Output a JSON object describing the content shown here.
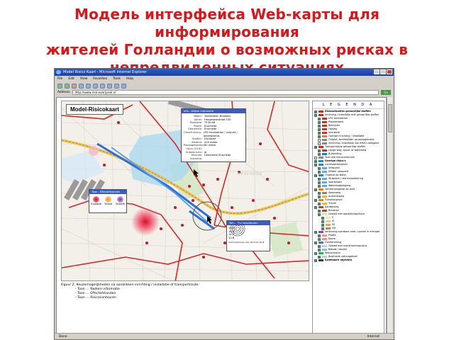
{
  "slide": {
    "title_lines": [
      "Модель интерфейса Web-карты для информирования",
      "жителей Голландии о возможных рисках в",
      "непредвиденных ситуациях"
    ]
  },
  "browser": {
    "window_title": "Model Risico Kaart - Microsoft Internet Explorer",
    "menu": [
      "File",
      "Edit",
      "View",
      "Favorites",
      "Tools",
      "Help"
    ],
    "address_label": "Address",
    "address_value": "http://www.risk-overijssel.nl",
    "go_label": "Go",
    "status_left": "Done",
    "status_zone": "Internet"
  },
  "map": {
    "title": "Model-Risicokaart",
    "place_label": "EVSCHEDE",
    "info_popup": {
      "header": "Info - Wijken informatie",
      "rows": [
        {
          "k": "Naam:",
          "v": "Tankstation Broekeln"
        },
        {
          "k": "Adres:",
          "v": "Hengelosestraat 100"
        },
        {
          "k": "Postcode:",
          "v": "7534 AB"
        },
        {
          "k": "Plaats:",
          "v": "Enschede"
        },
        {
          "k": "Gemeente:",
          "v": "Enschede"
        },
        {
          "k": "Omschrijving:",
          "v": "LPG tankstation / vulpunt / ondergronds"
        },
        {
          "k": "Stoffen:",
          "v": "Explosief"
        },
        {
          "k": "Afstand:",
          "v": "200 meter"
        },
        {
          "k": "Plaatsgebonden risico (10-6):",
          "v": "80 meter"
        },
        {
          "k": "Groepsrisico:",
          "v": "Ja"
        },
        {
          "k": "Verantw. instantie:",
          "v": "Gemeente Enschede"
        }
      ]
    },
    "effects_popup": {
      "header": "Toon - Effectafstanden",
      "items": [
        "Explosie",
        "Brand",
        "Gifwolk"
      ]
    },
    "contour_popup": {
      "header": "Toon - Risicocontouren",
      "items": [
        "10-5",
        "10-6",
        "10-7",
        "10-8"
      ],
      "note": "risicocontouren van 10-5 tot 10-8"
    }
  },
  "legend": {
    "title": "L E G E N D A",
    "items": [
      {
        "label": "Risicosituaties gevaarlijke stoffen",
        "level": 0,
        "checked": true,
        "color": "#d62828"
      },
      {
        "label": "Inrichting / installatie met gevaarlijke stoffen",
        "level": 1,
        "checked": true,
        "color": "#d62828"
      },
      {
        "label": "LPG tankstation",
        "level": 2,
        "checked": true,
        "color": "#c0392b"
      },
      {
        "label": "Propaantank",
        "level": 2,
        "checked": true,
        "color": "#c0392b"
      },
      {
        "label": "Bedrijven",
        "level": 2,
        "checked": true,
        "color": "#c0392b"
      },
      {
        "label": "Opslag",
        "level": 2,
        "checked": true,
        "color": "#c0392b"
      },
      {
        "label": "Vuurwerk",
        "level": 2,
        "checked": true,
        "color": "#c0392b"
      },
      {
        "label": "Overige inrichting / installatie",
        "level": 2,
        "checked": true,
        "color": "#e67e22"
      },
      {
        "label": "Ontplof, kernfasilitair op opslaglocatie",
        "level": 2,
        "checked": false,
        "color": "#888888"
      },
      {
        "label": "inrichting / installatie van BRZO-categorie",
        "level": 2,
        "checked": false,
        "color": "#888888"
      },
      {
        "label": "Transportroute gevaarlijke stoffen",
        "level": 1,
        "checked": true,
        "color": "#d62828"
      },
      {
        "label": "Lange weg, spoor- of waterweg",
        "level": 2,
        "checked": true,
        "color": "#d62828"
      },
      {
        "label": "Buisleiding",
        "level": 2,
        "checked": true,
        "color": "#2980b9"
      },
      {
        "label": "Toon alle risicocontouren",
        "level": 1,
        "checked": false,
        "color": "#888888"
      },
      {
        "label": "Overige risico's",
        "level": 0,
        "checked": true,
        "color": "#2e86c1"
      },
      {
        "label": "Luchtvaartongeval",
        "level": 1,
        "checked": true,
        "color": "#2e86c1"
      },
      {
        "label": "Vliegveld",
        "level": 2,
        "checked": true,
        "color": "#5dade2"
      },
      {
        "label": "Militair vliegveld",
        "level": 2,
        "checked": true,
        "color": "#5dade2"
      },
      {
        "label": "Ongeval op water",
        "level": 1,
        "checked": true,
        "color": "#2e86c1"
      },
      {
        "label": "Stuwdam / stormvloedkering",
        "level": 2,
        "checked": true,
        "color": "#5dade2"
      },
      {
        "label": "Vaarwegen",
        "level": 2,
        "checked": true,
        "color": "#5dade2"
      },
      {
        "label": "Waterwegtoegang",
        "level": 2,
        "checked": true,
        "color": "#5dade2"
      },
      {
        "label": "Verkeersongeval op land",
        "level": 1,
        "checked": true,
        "color": "#e67e22"
      },
      {
        "label": "Spoorweg",
        "level": 2,
        "checked": true,
        "color": "#7f8c8d"
      },
      {
        "label": "Autosnelweg",
        "level": 2,
        "checked": true,
        "color": "#f5b041"
      },
      {
        "label": "Tunnelongeval",
        "level": 1,
        "checked": true,
        "color": "#e67e22"
      },
      {
        "label": "Tunnel",
        "level": 2,
        "checked": true,
        "color": "#f5b041"
      },
      {
        "label": "Aardbeving",
        "level": 1,
        "checked": true,
        "color": "#a0522d"
      },
      {
        "label": "Breuklijn",
        "level": 2,
        "checked": true,
        "color": "#a0522d"
      },
      {
        "label": "Gebied met aardbevingsrisico",
        "level": 2,
        "checked": true,
        "color": "#f0d9b5"
      },
      {
        "label": "V",
        "level": 3,
        "checked": true,
        "color": "#f6e3c6"
      },
      {
        "label": "VI",
        "level": 3,
        "checked": true,
        "color": "#eac9a0"
      },
      {
        "label": "VII",
        "level": 3,
        "checked": true,
        "color": "#d9a878"
      },
      {
        "label": "VIII",
        "level": 3,
        "checked": true,
        "color": "#c08655"
      },
      {
        "label": "Verstoring openbare orde / paniek in menigte",
        "level": 1,
        "checked": true,
        "color": "#8e44ad"
      },
      {
        "label": "Plaats",
        "level": 2,
        "checked": true,
        "color": "#f1948a"
      },
      {
        "label": "Route",
        "level": 2,
        "checked": true,
        "color": "#f1948a"
      },
      {
        "label": "Overstroming",
        "level": 1,
        "checked": true,
        "color": "#2e86c1"
      },
      {
        "label": "Gebied met overstromingsrisico",
        "level": 2,
        "checked": true,
        "color": "#aed6f1"
      },
      {
        "label": "Bebost / bosrijk",
        "level": 2,
        "checked": true,
        "color": "#85c1e9"
      },
      {
        "label": "Natuurbrand",
        "level": 1,
        "checked": true,
        "color": "#27ae60"
      },
      {
        "label": "Bos/heide natuurgebied",
        "level": 2,
        "checked": true,
        "color": "#a9dfbf"
      },
      {
        "label": "Kwetsbare objecten",
        "level": 0,
        "checked": true,
        "color": "#2c3e50"
      }
    ]
  },
  "caption": {
    "lines": [
      "Figuur 2: Keuzemogelijkheden na aanklikken inrichting / installatie of transportroute:",
      "- Toon … Nadere informatie",
      "- Toon … Effectafstanden",
      "- Toon … Risicocontouren"
    ]
  }
}
